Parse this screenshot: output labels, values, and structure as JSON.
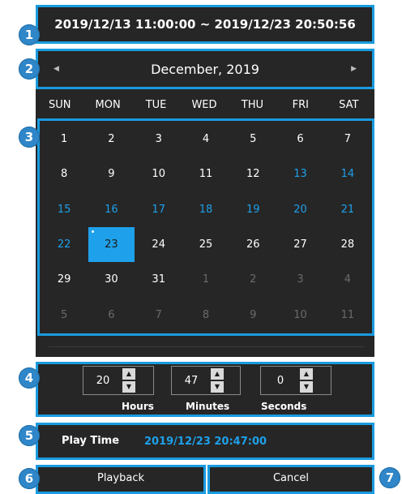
{
  "badges": [
    "1",
    "2",
    "3",
    "4",
    "5",
    "6",
    "7"
  ],
  "range": {
    "text": "2019/12/13 11:00:00 ~ 2019/12/23 20:50:56"
  },
  "calendar": {
    "month_title": "December, 2019",
    "prev_icon": "caret-left-icon",
    "next_icon": "caret-right-icon",
    "weekdays": [
      "SUN",
      "MON",
      "TUE",
      "WED",
      "THU",
      "FRI",
      "SAT"
    ],
    "days": [
      {
        "d": "1",
        "t": "normal"
      },
      {
        "d": "2",
        "t": "normal"
      },
      {
        "d": "3",
        "t": "normal"
      },
      {
        "d": "4",
        "t": "normal"
      },
      {
        "d": "5",
        "t": "normal"
      },
      {
        "d": "6",
        "t": "normal"
      },
      {
        "d": "7",
        "t": "normal"
      },
      {
        "d": "8",
        "t": "normal"
      },
      {
        "d": "9",
        "t": "normal"
      },
      {
        "d": "10",
        "t": "normal"
      },
      {
        "d": "11",
        "t": "normal"
      },
      {
        "d": "12",
        "t": "normal"
      },
      {
        "d": "13",
        "t": "blue"
      },
      {
        "d": "14",
        "t": "blue"
      },
      {
        "d": "15",
        "t": "blue"
      },
      {
        "d": "16",
        "t": "blue"
      },
      {
        "d": "17",
        "t": "blue"
      },
      {
        "d": "18",
        "t": "blue"
      },
      {
        "d": "19",
        "t": "blue"
      },
      {
        "d": "20",
        "t": "blue"
      },
      {
        "d": "21",
        "t": "blue"
      },
      {
        "d": "22",
        "t": "blue"
      },
      {
        "d": "23",
        "t": "selected"
      },
      {
        "d": "24",
        "t": "normal"
      },
      {
        "d": "25",
        "t": "normal"
      },
      {
        "d": "26",
        "t": "normal"
      },
      {
        "d": "27",
        "t": "normal"
      },
      {
        "d": "28",
        "t": "normal"
      },
      {
        "d": "29",
        "t": "normal"
      },
      {
        "d": "30",
        "t": "normal"
      },
      {
        "d": "31",
        "t": "normal"
      },
      {
        "d": "1",
        "t": "gray"
      },
      {
        "d": "2",
        "t": "gray"
      },
      {
        "d": "3",
        "t": "gray"
      },
      {
        "d": "4",
        "t": "gray"
      },
      {
        "d": "5",
        "t": "gray"
      },
      {
        "d": "6",
        "t": "gray"
      },
      {
        "d": "7",
        "t": "gray"
      },
      {
        "d": "8",
        "t": "gray"
      },
      {
        "d": "9",
        "t": "gray"
      },
      {
        "d": "10",
        "t": "gray"
      },
      {
        "d": "11",
        "t": "gray"
      }
    ]
  },
  "time": {
    "hours": {
      "value": "20",
      "label": "Hours"
    },
    "minutes": {
      "value": "47",
      "label": "Minutes"
    },
    "seconds": {
      "value": "0",
      "label": "Seconds"
    },
    "up_icon": "up-arrow-icon",
    "down_icon": "down-arrow-icon"
  },
  "play": {
    "label": "Play Time",
    "value": "2019/12/23 20:47:00"
  },
  "buttons": {
    "playback": "Playback",
    "cancel": "Cancel"
  },
  "colors": {
    "accent": "#1ea0ea",
    "panel": "#262626",
    "highlight": "#1a9be0"
  }
}
